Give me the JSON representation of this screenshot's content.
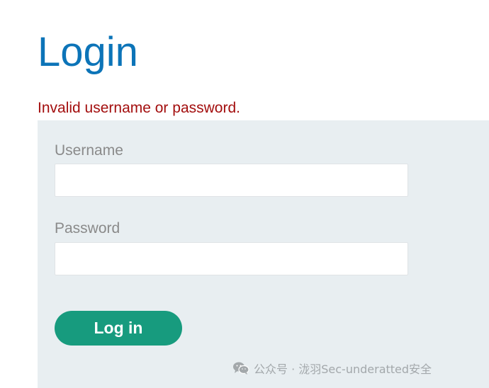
{
  "page": {
    "title": "Login",
    "error_message": "Invalid username or password."
  },
  "form": {
    "username_label": "Username",
    "username_value": "",
    "password_label": "Password",
    "password_value": "",
    "submit_label": "Log in"
  },
  "watermark": {
    "icon": "wechat-icon",
    "text": "公众号 · 泷羽Sec-underatted安全"
  },
  "colors": {
    "title": "#0c74b8",
    "error": "#a30e0e",
    "panel_background": "#e8eef1",
    "button": "#179b7e",
    "label": "#8a8a8a"
  }
}
